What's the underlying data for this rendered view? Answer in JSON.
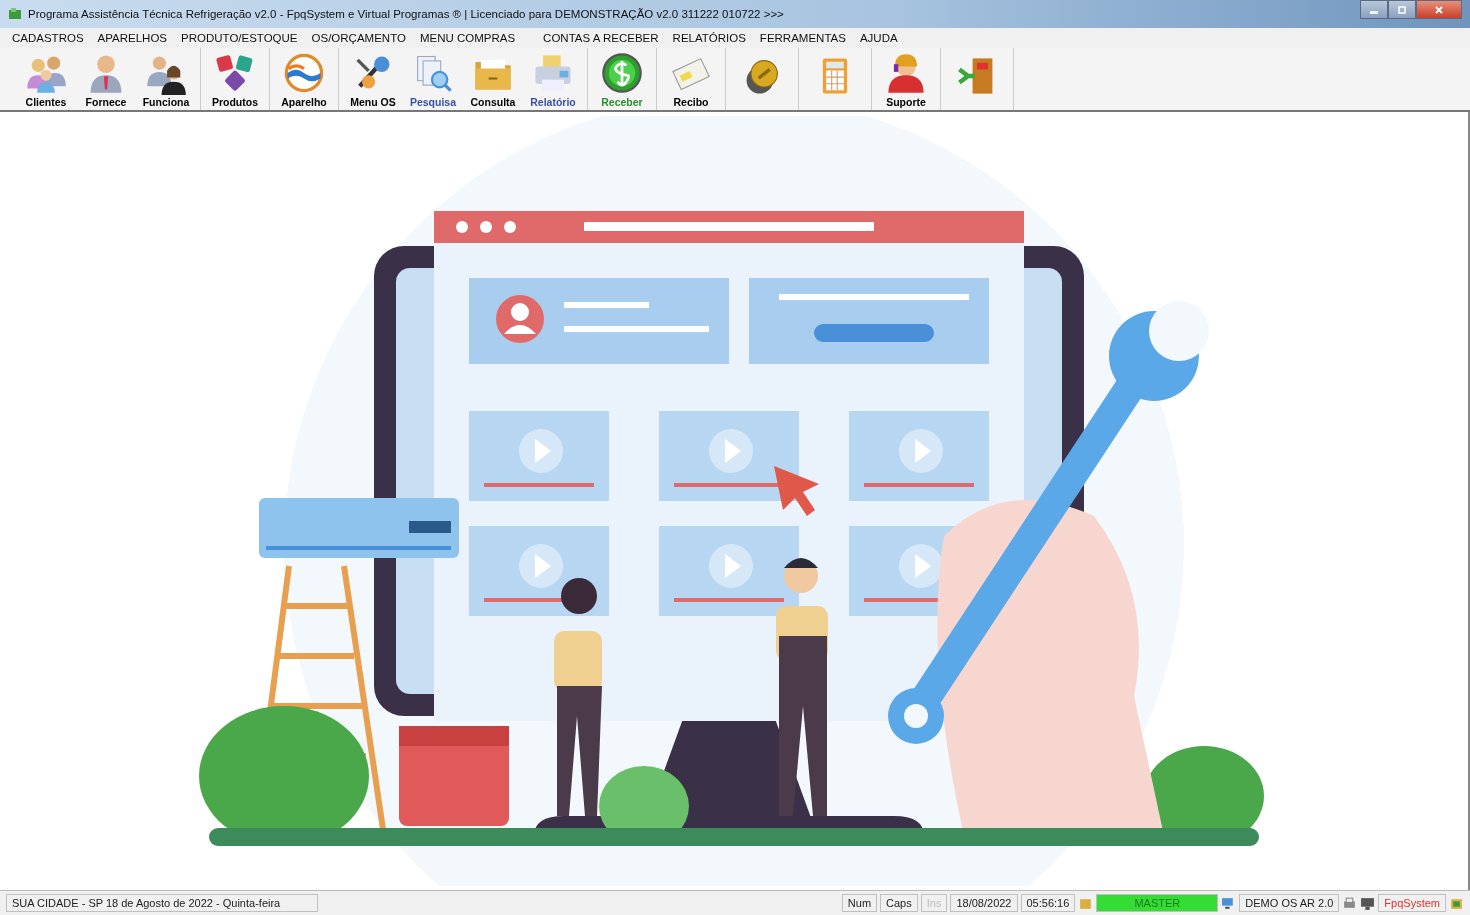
{
  "window": {
    "title": "Programa Assistência Técnica Refrigeração v2.0 - FpqSystem e Virtual Programas ® | Licenciado para  DEMONSTRAÇÃO v2.0 311222 010722 >>>"
  },
  "menu": [
    "CADASTROS",
    "APARELHOS",
    "PRODUTO/ESTOQUE",
    "OS/ORÇAMENTO",
    "MENU COMPRAS",
    "CONTAS A RECEBER",
    "RELATÓRIOS",
    "FERRAMENTAS",
    "AJUDA"
  ],
  "toolbar": {
    "groups": [
      {
        "items": [
          {
            "label": "Clientes",
            "color": "#000000"
          },
          {
            "label": "Fornece",
            "color": "#000000"
          },
          {
            "label": "Funciona",
            "color": "#000000"
          }
        ]
      },
      {
        "items": [
          {
            "label": "Produtos",
            "color": "#000000"
          }
        ]
      },
      {
        "items": [
          {
            "label": "Aparelho",
            "color": "#000000"
          }
        ]
      },
      {
        "items": [
          {
            "label": "Menu OS",
            "color": "#000000"
          },
          {
            "label": "Pesquisa",
            "color": "#3a4fa0"
          },
          {
            "label": "Consulta",
            "color": "#000000"
          },
          {
            "label": "Relatório",
            "color": "#3a4fa0"
          }
        ]
      },
      {
        "items": [
          {
            "label": "Receber",
            "color": "#2e8b2e"
          }
        ]
      },
      {
        "items": [
          {
            "label": "Recibo",
            "color": "#000000"
          }
        ]
      },
      {
        "items": [
          {
            "kind": "icon_only"
          }
        ]
      },
      {
        "items": [
          {
            "kind": "icon_only"
          }
        ]
      },
      {
        "items": [
          {
            "label": "Suporte",
            "color": "#000000"
          }
        ]
      },
      {
        "items": [
          {
            "kind": "icon_only"
          }
        ]
      }
    ]
  },
  "status_bar": {
    "location": "SUA CIDADE - SP 18 de Agosto de 2022 - Quinta-feira",
    "keys": [
      {
        "label": "Num",
        "disabled": false
      },
      {
        "label": "Caps",
        "disabled": false
      },
      {
        "label": "Ins",
        "disabled": true
      }
    ],
    "date": "18/08/2022",
    "time": "05:56:16",
    "user": "MASTER",
    "version": "DEMO OS AR 2.0",
    "brand": "FpqSystem"
  }
}
